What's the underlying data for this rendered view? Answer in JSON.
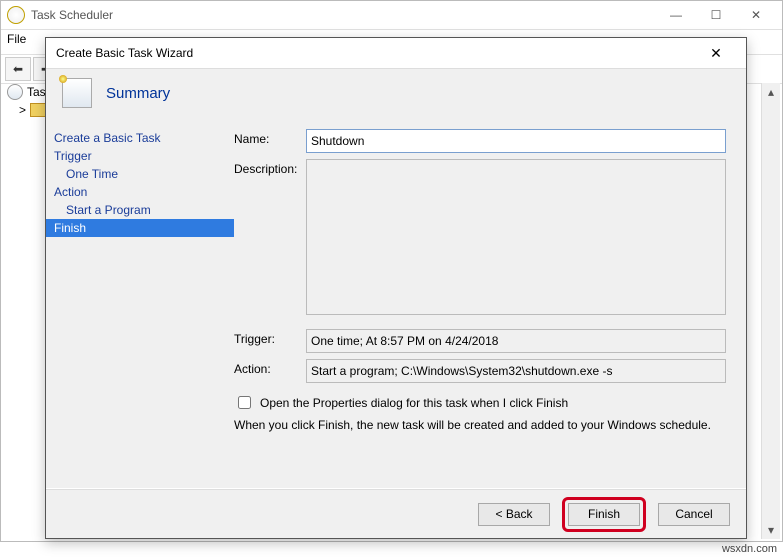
{
  "window": {
    "title": "Task Scheduler",
    "menu": {
      "file": "File"
    },
    "controls": {
      "min": "—",
      "max": "☐",
      "close": "✕"
    },
    "nav": {
      "back": "⬅",
      "fwd": "➡"
    },
    "tree": {
      "root": "Tas",
      "expand": ">"
    }
  },
  "wizard": {
    "title": "Create Basic Task Wizard",
    "close": "✕",
    "header": "Summary",
    "steps": {
      "create": "Create a Basic Task",
      "trigger": "Trigger",
      "trigger_sub": "One Time",
      "action": "Action",
      "action_sub": "Start a Program",
      "finish": "Finish"
    },
    "labels": {
      "name": "Name:",
      "description": "Description:",
      "trigger": "Trigger:",
      "action": "Action:"
    },
    "values": {
      "name": "Shutdown",
      "description": "",
      "trigger": "One time; At 8:57 PM on 4/24/2018",
      "action": "Start a program; C:\\Windows\\System32\\shutdown.exe -s"
    },
    "checkbox_label": "Open the Properties dialog for this task when I click Finish",
    "info": "When you click Finish, the new task will be created and added to your Windows schedule.",
    "buttons": {
      "back": "<  Back",
      "finish": "Finish",
      "cancel": "Cancel"
    }
  },
  "watermark": "wsxdn.com"
}
